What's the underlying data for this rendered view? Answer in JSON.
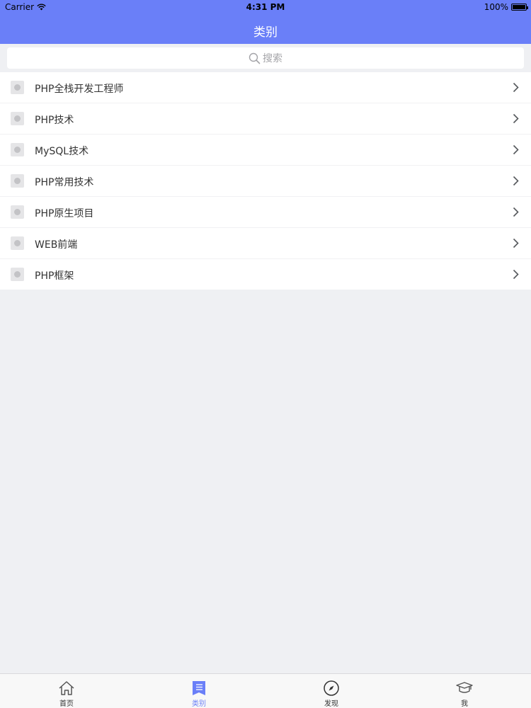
{
  "status_bar": {
    "carrier": "Carrier",
    "time": "4:31 PM",
    "battery": "100%"
  },
  "nav": {
    "title": "类别"
  },
  "search": {
    "placeholder": "搜索"
  },
  "categories": [
    {
      "label": "PHP全栈开发工程师"
    },
    {
      "label": "PHP技术"
    },
    {
      "label": "MySQL技术"
    },
    {
      "label": "PHP常用技术"
    },
    {
      "label": "PHP原生项目"
    },
    {
      "label": "WEB前端"
    },
    {
      "label": "PHP框架"
    }
  ],
  "tabbar": {
    "tabs": [
      {
        "label": "首页",
        "icon": "home-icon",
        "active": false
      },
      {
        "label": "类别",
        "icon": "list-icon",
        "active": true
      },
      {
        "label": "发现",
        "icon": "compass-icon",
        "active": false
      },
      {
        "label": "我",
        "icon": "graduation-cap-icon",
        "active": false
      }
    ]
  },
  "colors": {
    "accent": "#6a7ff8",
    "background": "#eff0f3"
  }
}
